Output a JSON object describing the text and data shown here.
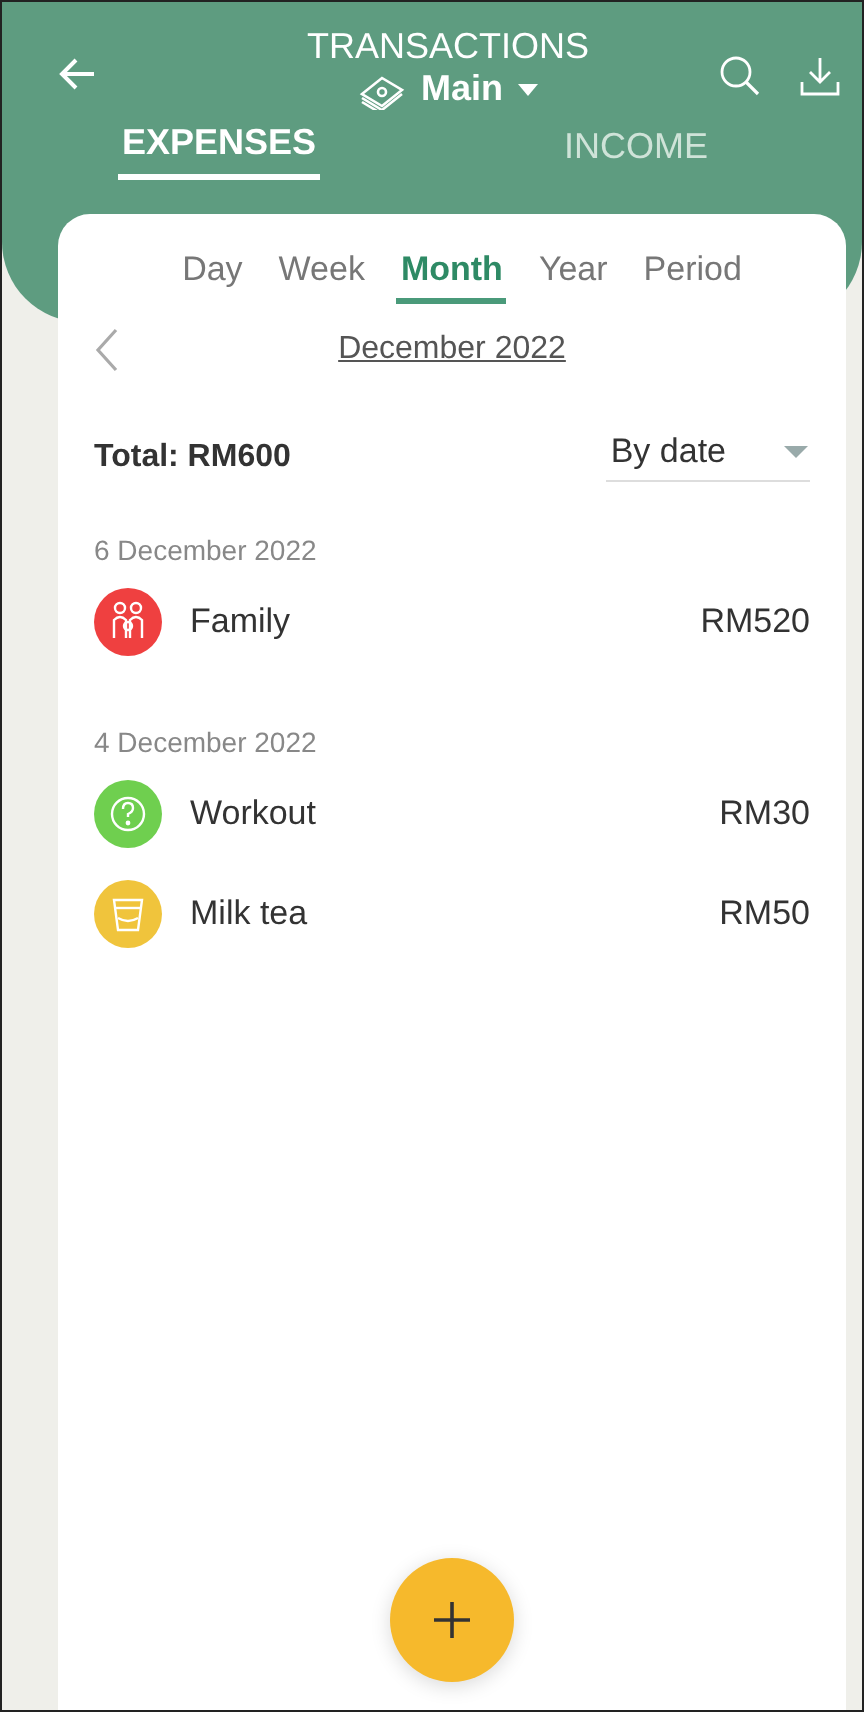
{
  "header": {
    "title": "TRANSACTIONS",
    "account": "Main"
  },
  "tabs": [
    {
      "label": "EXPENSES",
      "selected": true
    },
    {
      "label": "INCOME",
      "selected": false
    }
  ],
  "periods": [
    {
      "label": "Day",
      "selected": false
    },
    {
      "label": "Week",
      "selected": false
    },
    {
      "label": "Month",
      "selected": true
    },
    {
      "label": "Year",
      "selected": false
    },
    {
      "label": "Period",
      "selected": false
    }
  ],
  "current_period": "December 2022",
  "total": "Total: RM600",
  "sort": "By date",
  "groups": [
    {
      "date": "6 December 2022",
      "items": [
        {
          "kind": "family",
          "name": "Family",
          "amount": "RM520",
          "color": "#ef4040"
        }
      ]
    },
    {
      "date": "4 December 2022",
      "items": [
        {
          "kind": "workout",
          "name": "Workout",
          "amount": "RM30",
          "color": "#6fcf4f"
        },
        {
          "kind": "drink",
          "name": "Milk tea",
          "amount": "RM50",
          "color": "#f0c43c"
        }
      ]
    }
  ]
}
